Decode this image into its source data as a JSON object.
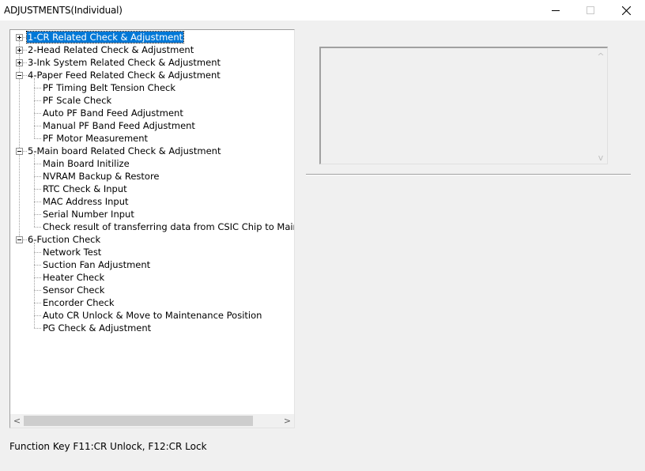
{
  "window": {
    "title": "ADJUSTMENTS(Individual)",
    "minimize_glyph": "–",
    "maximize_glyph": "□",
    "close_glyph": "✕"
  },
  "tree": {
    "items": [
      {
        "label": "1-CR Related Check & Adjustment",
        "selected": true,
        "expanded": false
      },
      {
        "label": "2-Head Related Check & Adjustment",
        "expanded": false
      },
      {
        "label": "3-Ink System Related Check & Adjustment",
        "expanded": false
      },
      {
        "label": "4-Paper Feed Related Check & Adjustment",
        "expanded": true,
        "children": [
          "PF Timing Belt Tension Check",
          "PF Scale Check",
          "Auto PF Band Feed Adjustment",
          "Manual PF Band Feed Adjustment",
          "PF Motor Measurement"
        ]
      },
      {
        "label": "5-Main board Related Check & Adjustment",
        "expanded": true,
        "children": [
          "Main Board Initilize",
          "NVRAM Backup & Restore",
          "RTC Check & Input",
          "MAC Address Input",
          "Serial Number Input",
          "Check result of transferring data from CSIC Chip to Main"
        ]
      },
      {
        "label": "6-Fuction Check",
        "expanded": true,
        "children": [
          "Network Test",
          "Suction Fan Adjustment",
          "Heater Check",
          "Sensor Check",
          "Encorder Check",
          "Auto CR Unlock & Move to Maintenance Position",
          "PG Check & Adjustment"
        ]
      }
    ]
  },
  "scrollbar": {
    "left_arrow": "<",
    "right_arrow": ">",
    "up_arrow": "^",
    "down_arrow": "v"
  },
  "status": {
    "text": "Function Key F11:CR Unlock, F12:CR Lock"
  },
  "colors": {
    "selection": "#0078d7",
    "background": "#f0f0f0"
  }
}
